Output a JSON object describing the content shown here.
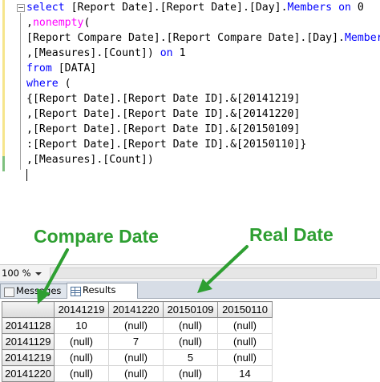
{
  "editor": {
    "lines": [
      [
        {
          "t": "select ",
          "c": "kw"
        },
        {
          "t": "[Report Date].[Report Date].[Day]."
        },
        {
          "t": "Members",
          "c": "kw"
        },
        {
          "t": " "
        },
        {
          "t": "on",
          "c": "kw"
        },
        {
          "t": " 0"
        }
      ],
      [
        {
          "t": ","
        },
        {
          "t": "nonempty",
          "c": "fn"
        },
        {
          "t": "("
        }
      ],
      [
        {
          "t": "[Report Compare Date].[Report Compare Date].[Day]."
        },
        {
          "t": "Members",
          "c": "kw"
        }
      ],
      [
        {
          "t": ",[Measures].[Count]) "
        },
        {
          "t": "on",
          "c": "kw"
        },
        {
          "t": " 1"
        }
      ],
      [
        {
          "t": "from",
          "c": "kw"
        },
        {
          "t": " [DATA]"
        }
      ],
      [
        {
          "t": "where",
          "c": "kw"
        },
        {
          "t": " ("
        }
      ],
      [
        {
          "t": "{[Report Date].[Report Date ID].&[20141219]"
        }
      ],
      [
        {
          "t": ",[Report Date].[Report Date ID].&[20141220]"
        }
      ],
      [
        {
          "t": ",[Report Date].[Report Date ID].&[20150109]"
        }
      ],
      [
        {
          "t": ":[Report Date].[Report Date ID].&[20150110]}"
        }
      ],
      [
        {
          "t": ",[Measures].[Count])"
        }
      ],
      [
        {
          "t": "",
          "caret": true
        }
      ]
    ]
  },
  "annotations": {
    "compare_date": "Compare Date",
    "real_date": "Real Date",
    "color": "#2e9f32"
  },
  "status": {
    "zoom": "100 %"
  },
  "tabs": {
    "messages": "Messages",
    "results": "Results"
  },
  "grid": {
    "columns": [
      "20141219",
      "20141220",
      "20150109",
      "20150110"
    ],
    "rows": [
      {
        "label": "20141128",
        "cells": [
          "10",
          "(null)",
          "(null)",
          "(null)"
        ]
      },
      {
        "label": "20141129",
        "cells": [
          "(null)",
          "7",
          "(null)",
          "(null)"
        ]
      },
      {
        "label": "20141219",
        "cells": [
          "(null)",
          "(null)",
          "5",
          "(null)"
        ]
      },
      {
        "label": "20141220",
        "cells": [
          "(null)",
          "(null)",
          "(null)",
          "14"
        ]
      }
    ]
  }
}
